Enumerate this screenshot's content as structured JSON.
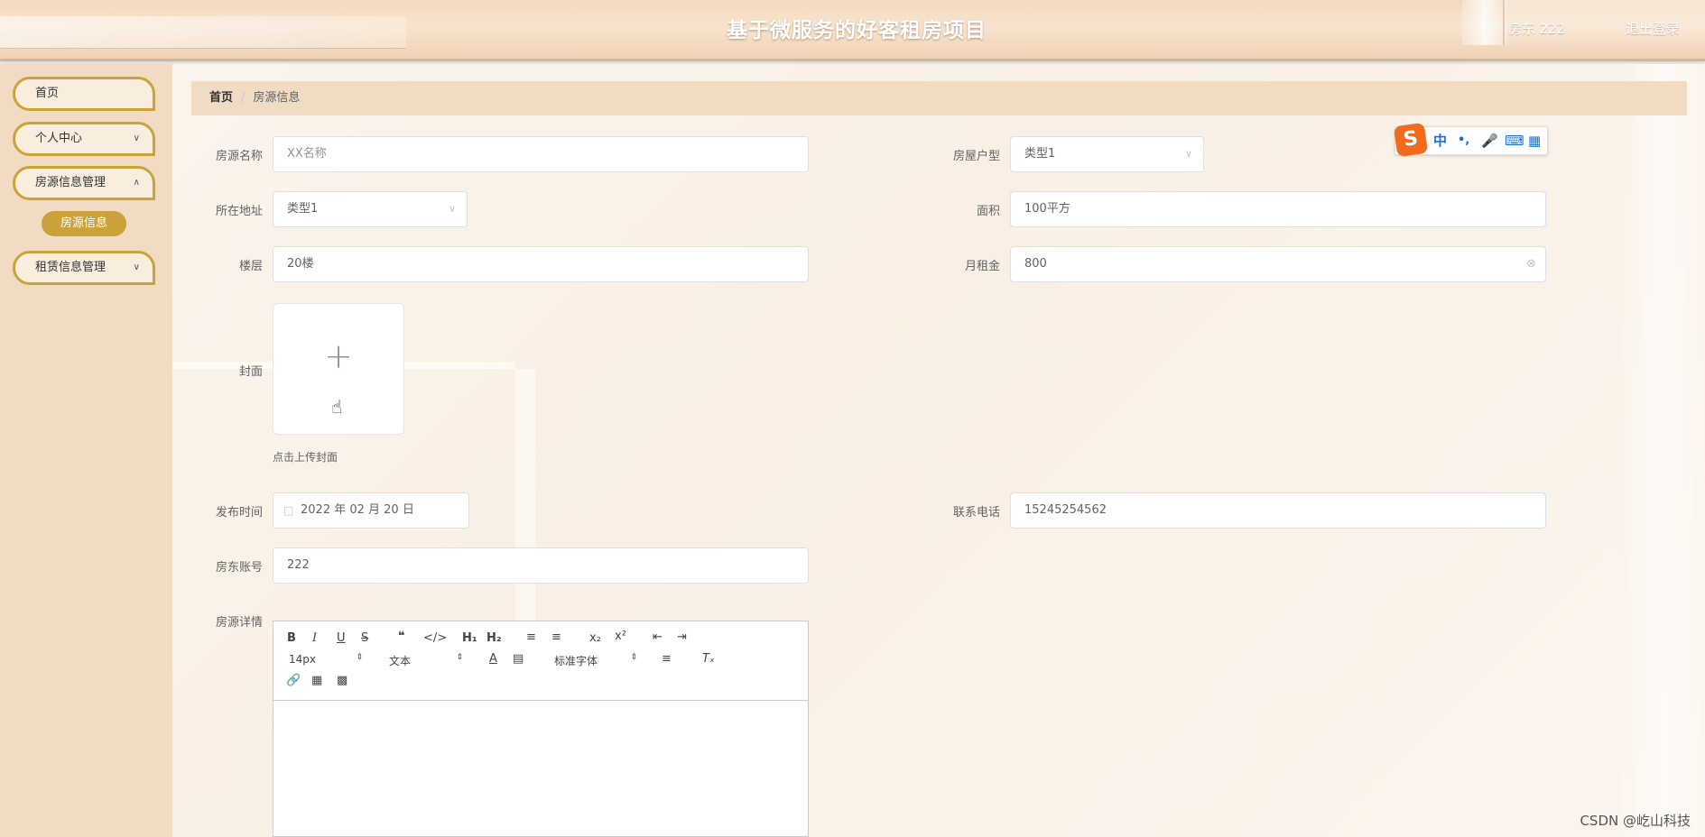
{
  "header": {
    "title": "基于微服务的好客租房项目",
    "user": "房东 222",
    "logout": "退出登录"
  },
  "sidebar": {
    "items": [
      {
        "label": "首页"
      },
      {
        "label": "个人中心"
      },
      {
        "label": "房源信息管理"
      },
      {
        "label": "租赁信息管理"
      }
    ],
    "submenu_active": "房源信息"
  },
  "breadcrumb": {
    "home": "首页",
    "separator": "/",
    "current": "房源信息"
  },
  "form": {
    "name": {
      "label": "房源名称",
      "value": "XX名称"
    },
    "house_type": {
      "label": "房屋户型",
      "value": "类型1"
    },
    "address": {
      "label": "所在地址",
      "value": "类型1"
    },
    "area": {
      "label": "面积",
      "value": "100平方"
    },
    "floor": {
      "label": "楼层",
      "value": "20楼"
    },
    "rent": {
      "label": "月租金",
      "value": "800"
    },
    "cover": {
      "label": "封面",
      "tip": "点击上传封面"
    },
    "publish_time": {
      "label": "发布时间",
      "value": "2022 年 02 月 20 日"
    },
    "phone": {
      "label": "联系电话",
      "value": "15245254562"
    },
    "landlord_account": {
      "label": "房东账号",
      "value": "222"
    },
    "details": {
      "label": "房源详情"
    }
  },
  "editor": {
    "size_value": "14px",
    "header_value": "文本",
    "font_value": "标准字体"
  },
  "ime": {
    "logo": "S",
    "lang": "中",
    "punct": "•,"
  },
  "watermark": "CSDN @屹山科技",
  "colors": {
    "accent": "#c9a23a",
    "sidebar_bg": "#f1dcc3",
    "header_bg": "#f3d9bd"
  }
}
